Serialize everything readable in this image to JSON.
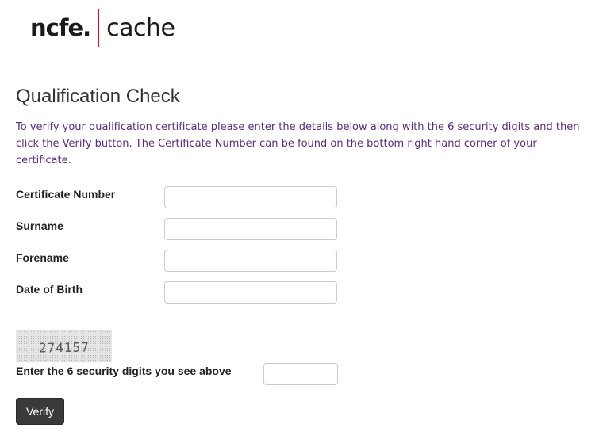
{
  "logo": {
    "brand_left": "ncfe.",
    "brand_right": "cache"
  },
  "page": {
    "title": "Qualification Check",
    "intro": "To verify your qualification certificate please enter the details below along with the 6 security digits and then click the Verify button.  The Certificate Number can be found on the bottom right hand corner of your certificate."
  },
  "form": {
    "certificate_number": {
      "label": "Certificate Number",
      "value": ""
    },
    "surname": {
      "label": "Surname",
      "value": ""
    },
    "forename": {
      "label": "Forename",
      "value": ""
    },
    "date_of_birth": {
      "label": "Date of Birth",
      "value": ""
    },
    "captcha": {
      "image_text": "274157",
      "label": "Enter the 6 security digits you see above",
      "value": ""
    },
    "verify_label": "Verify"
  },
  "colors": {
    "intro_text": "#5a2d7a",
    "logo_divider": "#e3001b",
    "button_bg": "#3a3a3a"
  }
}
